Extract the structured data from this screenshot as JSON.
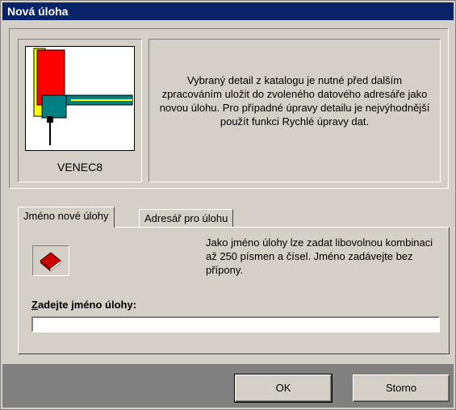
{
  "window": {
    "title": "Nová úloha"
  },
  "preview": {
    "name": "VENEC8"
  },
  "description": "Vybraný detail z katalogu je nutné před dalším zpracováním uložit do zvoleného datového adresáře jako novou úlohu. Pro případné úpravy detailu je nejvýhodnější použít funkci Rychlé úpravy dat.",
  "tabs": [
    {
      "label": "Jméno nové úlohy",
      "active": true
    },
    {
      "label": "Adresář pro úlohu",
      "active": false
    }
  ],
  "name_tab": {
    "hint": "Jako jméno úlohy lze zadat libovolnou kombinaci až 250 písmen a čísel. Jméno zadávejte bez přípony.",
    "field_label_mnemonic": "Z",
    "field_label_rest": "adejte jméno úlohy:",
    "field_value": ""
  },
  "buttons": {
    "ok": "OK",
    "cancel": "Storno"
  },
  "icons": {
    "book": "book-icon"
  },
  "colors": {
    "titlebar": "#0a246a",
    "face": "#d4d0c8",
    "footer": "#808080",
    "drawing_red": "#ff0000",
    "drawing_teal": "#008080",
    "drawing_yellow": "#ffff00"
  }
}
